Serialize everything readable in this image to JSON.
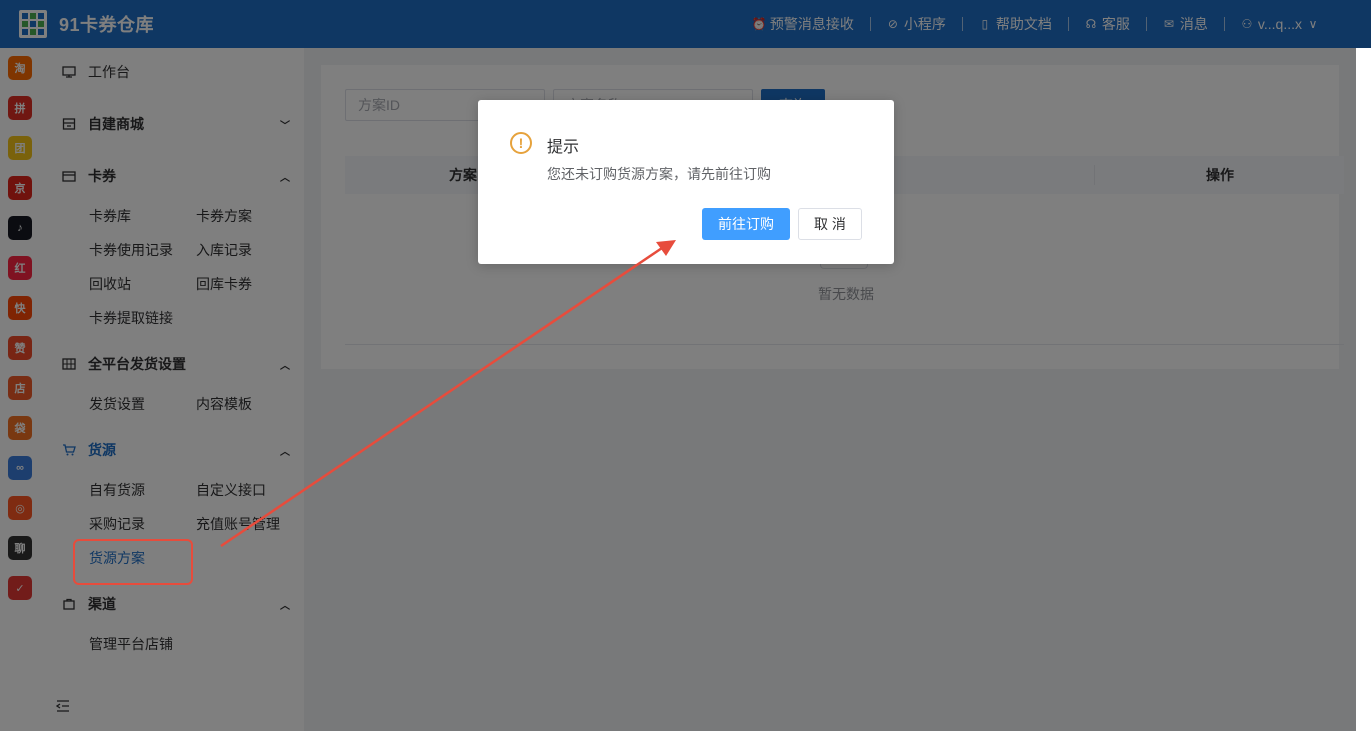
{
  "header": {
    "app_title": "91卡券仓库",
    "nav": [
      {
        "label": "预警消息接收",
        "icon": "alert-bell-icon"
      },
      {
        "label": "小程序",
        "icon": "mini-program-icon"
      },
      {
        "label": "帮助文档",
        "icon": "document-icon"
      },
      {
        "label": "客服",
        "icon": "headset-icon"
      },
      {
        "label": "消息",
        "icon": "mail-icon"
      }
    ],
    "user": "v...q...x"
  },
  "app_strip": [
    {
      "icon": "taobao-icon",
      "text": "淘",
      "color": "#ff6a00"
    },
    {
      "icon": "pinduoduo-icon",
      "text": "拼",
      "color": "#e02e24"
    },
    {
      "icon": "app-icon-3",
      "text": "团",
      "color": "#f5c518"
    },
    {
      "icon": "jd-icon",
      "text": "京",
      "color": "#e1251b"
    },
    {
      "icon": "douyin-icon",
      "text": "♪",
      "color": "#161823"
    },
    {
      "icon": "xiaohongshu-icon",
      "text": "红",
      "color": "#ff2442"
    },
    {
      "icon": "kuaishou-icon",
      "text": "快",
      "color": "#ff4906"
    },
    {
      "icon": "thumbs-up-icon",
      "text": "赞",
      "color": "#f04a28"
    },
    {
      "icon": "store-icon",
      "text": "店",
      "color": "#f05a28"
    },
    {
      "icon": "shopping-bag-icon",
      "text": "袋",
      "color": "#f27022"
    },
    {
      "icon": "link-icon",
      "text": "∞",
      "color": "#3b7ddd"
    },
    {
      "icon": "app-icon-12",
      "text": "◎",
      "color": "#ff5722"
    },
    {
      "icon": "app-icon-13",
      "text": "聊",
      "color": "#333333"
    },
    {
      "icon": "app-icon-14",
      "text": "✓",
      "color": "#e53935"
    }
  ],
  "sidebar": {
    "workbench": "工作台",
    "self_mall": "自建商城",
    "coupons": {
      "label": "卡券",
      "items": [
        "卡券库",
        "卡券方案",
        "卡券使用记录",
        "入库记录",
        "回收站",
        "回库卡券",
        "卡券提取链接"
      ]
    },
    "delivery": {
      "label": "全平台发货设置",
      "items": [
        "发货设置",
        "内容模板"
      ]
    },
    "supply": {
      "label": "货源",
      "items": [
        "自有货源",
        "自定义接口",
        "采购记录",
        "充值账号管理",
        "货源方案"
      ]
    },
    "channel": {
      "label": "渠道",
      "items": [
        "管理平台店铺"
      ]
    }
  },
  "main": {
    "filter_placeholder": "方案ID",
    "filter2_placeholder": "方案名称",
    "search_label": "查询",
    "columns": [
      "方案ID",
      "操作"
    ],
    "empty_text": "暂无数据"
  },
  "dialog": {
    "title": "提示",
    "message": "您还未订购货源方案，请先前往订购",
    "confirm": "前往订购",
    "cancel": "取 消",
    "icon_color": "#e6a23c"
  },
  "colors": {
    "brand": "#1f6ec6",
    "primary_button": "#409eff",
    "annotation": "#e74c3c"
  }
}
